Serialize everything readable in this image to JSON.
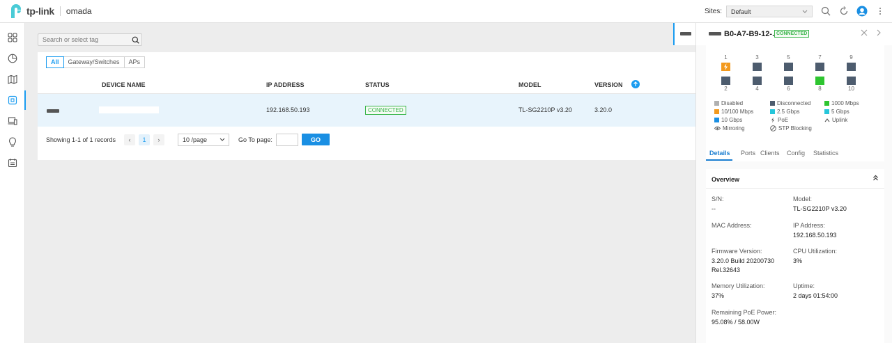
{
  "header": {
    "brand": "tp-link",
    "product": "omada",
    "sites_label": "Sites:",
    "site_selected": "Default"
  },
  "search": {
    "placeholder": "Search or select tag"
  },
  "filters": [
    "All",
    "Gateway/Switches",
    "APs"
  ],
  "table": {
    "columns": [
      "DEVICE NAME",
      "IP ADDRESS",
      "STATUS",
      "MODEL",
      "VERSION"
    ],
    "rows": [
      {
        "name": "",
        "ip": "192.168.50.193",
        "status": "CONNECTED",
        "model": "TL-SG2210P v3.20",
        "version": "3.20.0"
      }
    ]
  },
  "pager": {
    "showing": "Showing 1-1 of 1 records",
    "current_page": "1",
    "per_page": "10 /page",
    "goto_label": "Go To page:",
    "go": "GO",
    "prev": "‹",
    "next": "›"
  },
  "drawer": {
    "title": "B0-A7-B9-12-...",
    "status": "CONNECTED",
    "ports_top": [
      "1",
      "3",
      "5",
      "7",
      "9"
    ],
    "ports_bottom": [
      "2",
      "4",
      "6",
      "8",
      "10"
    ],
    "legend": [
      {
        "label": "Disabled",
        "color": "#b0b0b0"
      },
      {
        "label": "Disconnected",
        "color": "#4d5c6e"
      },
      {
        "label": "1000 Mbps",
        "color": "#2ec530"
      },
      {
        "label": "10/100 Mbps",
        "color": "#f39a1e"
      },
      {
        "label": "2.5 Gbps",
        "color": "#26c6da"
      },
      {
        "label": "5 Gbps",
        "color": "#26c6da"
      },
      {
        "label": "10 Gbps",
        "color": "#1a8fe3"
      },
      {
        "label": "PoE",
        "icon": "bolt-icon"
      },
      {
        "label": "Uplink",
        "icon": "caret-up-icon"
      },
      {
        "label": "Mirroring",
        "icon": "eye-icon"
      },
      {
        "label": "STP Blocking",
        "icon": "block-icon"
      }
    ],
    "tabs": [
      "Details",
      "Ports",
      "Clients",
      "Config",
      "Statistics"
    ],
    "overview": {
      "title": "Overview",
      "sn_label": "S/N:",
      "sn": "--",
      "model_label": "Model:",
      "model": "TL-SG2210P v3.20",
      "mac_label": "MAC Address:",
      "ip_label": "IP Address:",
      "ip": "192.168.50.193",
      "fw_label": "Firmware Version:",
      "fw": "3.20.0 Build 20200730 Rel.32643",
      "cpu_label": "CPU Utilization:",
      "cpu": "3%",
      "mem_label": "Memory Utilization:",
      "mem": "37%",
      "uptime_label": "Uptime:",
      "uptime": "2 days 01:54:00",
      "poe_label": "Remaining PoE Power:",
      "poe": "95.08% / 58.00W"
    }
  },
  "colors": {
    "accent": "#1a9cf0",
    "connected": "#3ab54a",
    "poe": "#f39a1e",
    "g1000": "#2ec530",
    "disconnected": "#4d5c6e"
  }
}
